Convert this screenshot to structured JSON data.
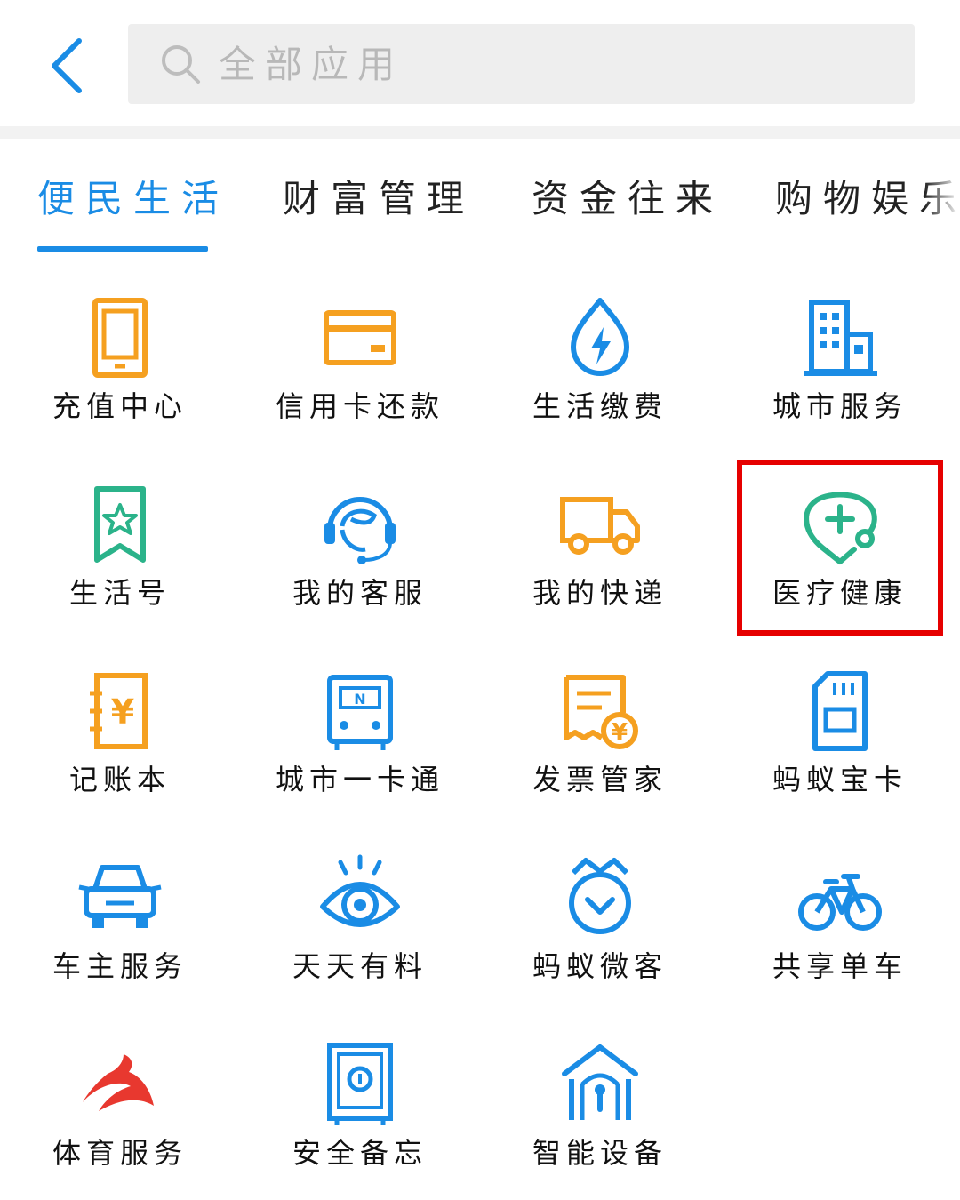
{
  "header": {
    "search_placeholder": "全部应用"
  },
  "tabs": [
    {
      "label": "便民生活",
      "active": true
    },
    {
      "label": "财富管理",
      "active": false
    },
    {
      "label": "资金往来",
      "active": false
    },
    {
      "label": "购物娱乐",
      "active": false
    }
  ],
  "apps": [
    {
      "label": "充值中心",
      "icon": "phone-recharge-icon"
    },
    {
      "label": "信用卡还款",
      "icon": "credit-card-icon"
    },
    {
      "label": "生活缴费",
      "icon": "utility-drop-icon"
    },
    {
      "label": "城市服务",
      "icon": "building-icon"
    },
    {
      "label": "生活号",
      "icon": "bookmark-star-icon"
    },
    {
      "label": "我的客服",
      "icon": "headset-icon"
    },
    {
      "label": "我的快递",
      "icon": "delivery-truck-icon"
    },
    {
      "label": "医疗健康",
      "icon": "stethoscope-icon"
    },
    {
      "label": "记账本",
      "icon": "ledger-yuan-icon"
    },
    {
      "label": "城市一卡通",
      "icon": "transit-card-icon"
    },
    {
      "label": "发票管家",
      "icon": "invoice-icon"
    },
    {
      "label": "蚂蚁宝卡",
      "icon": "sim-card-icon"
    },
    {
      "label": "车主服务",
      "icon": "car-icon"
    },
    {
      "label": "天天有料",
      "icon": "eye-icon"
    },
    {
      "label": "蚂蚁微客",
      "icon": "shield-check-icon"
    },
    {
      "label": "共享单车",
      "icon": "bicycle-icon"
    },
    {
      "label": "体育服务",
      "icon": "sports-swoosh-icon"
    },
    {
      "label": "安全备忘",
      "icon": "safe-icon"
    },
    {
      "label": "智能设备",
      "icon": "smart-home-icon"
    }
  ],
  "highlighted_app": "医疗健康",
  "colors": {
    "accent_blue": "#1a8ce5",
    "orange": "#f5a020",
    "green": "#2bb38a",
    "red_highlight": "#e60000",
    "sports_red": "#e8382f"
  }
}
